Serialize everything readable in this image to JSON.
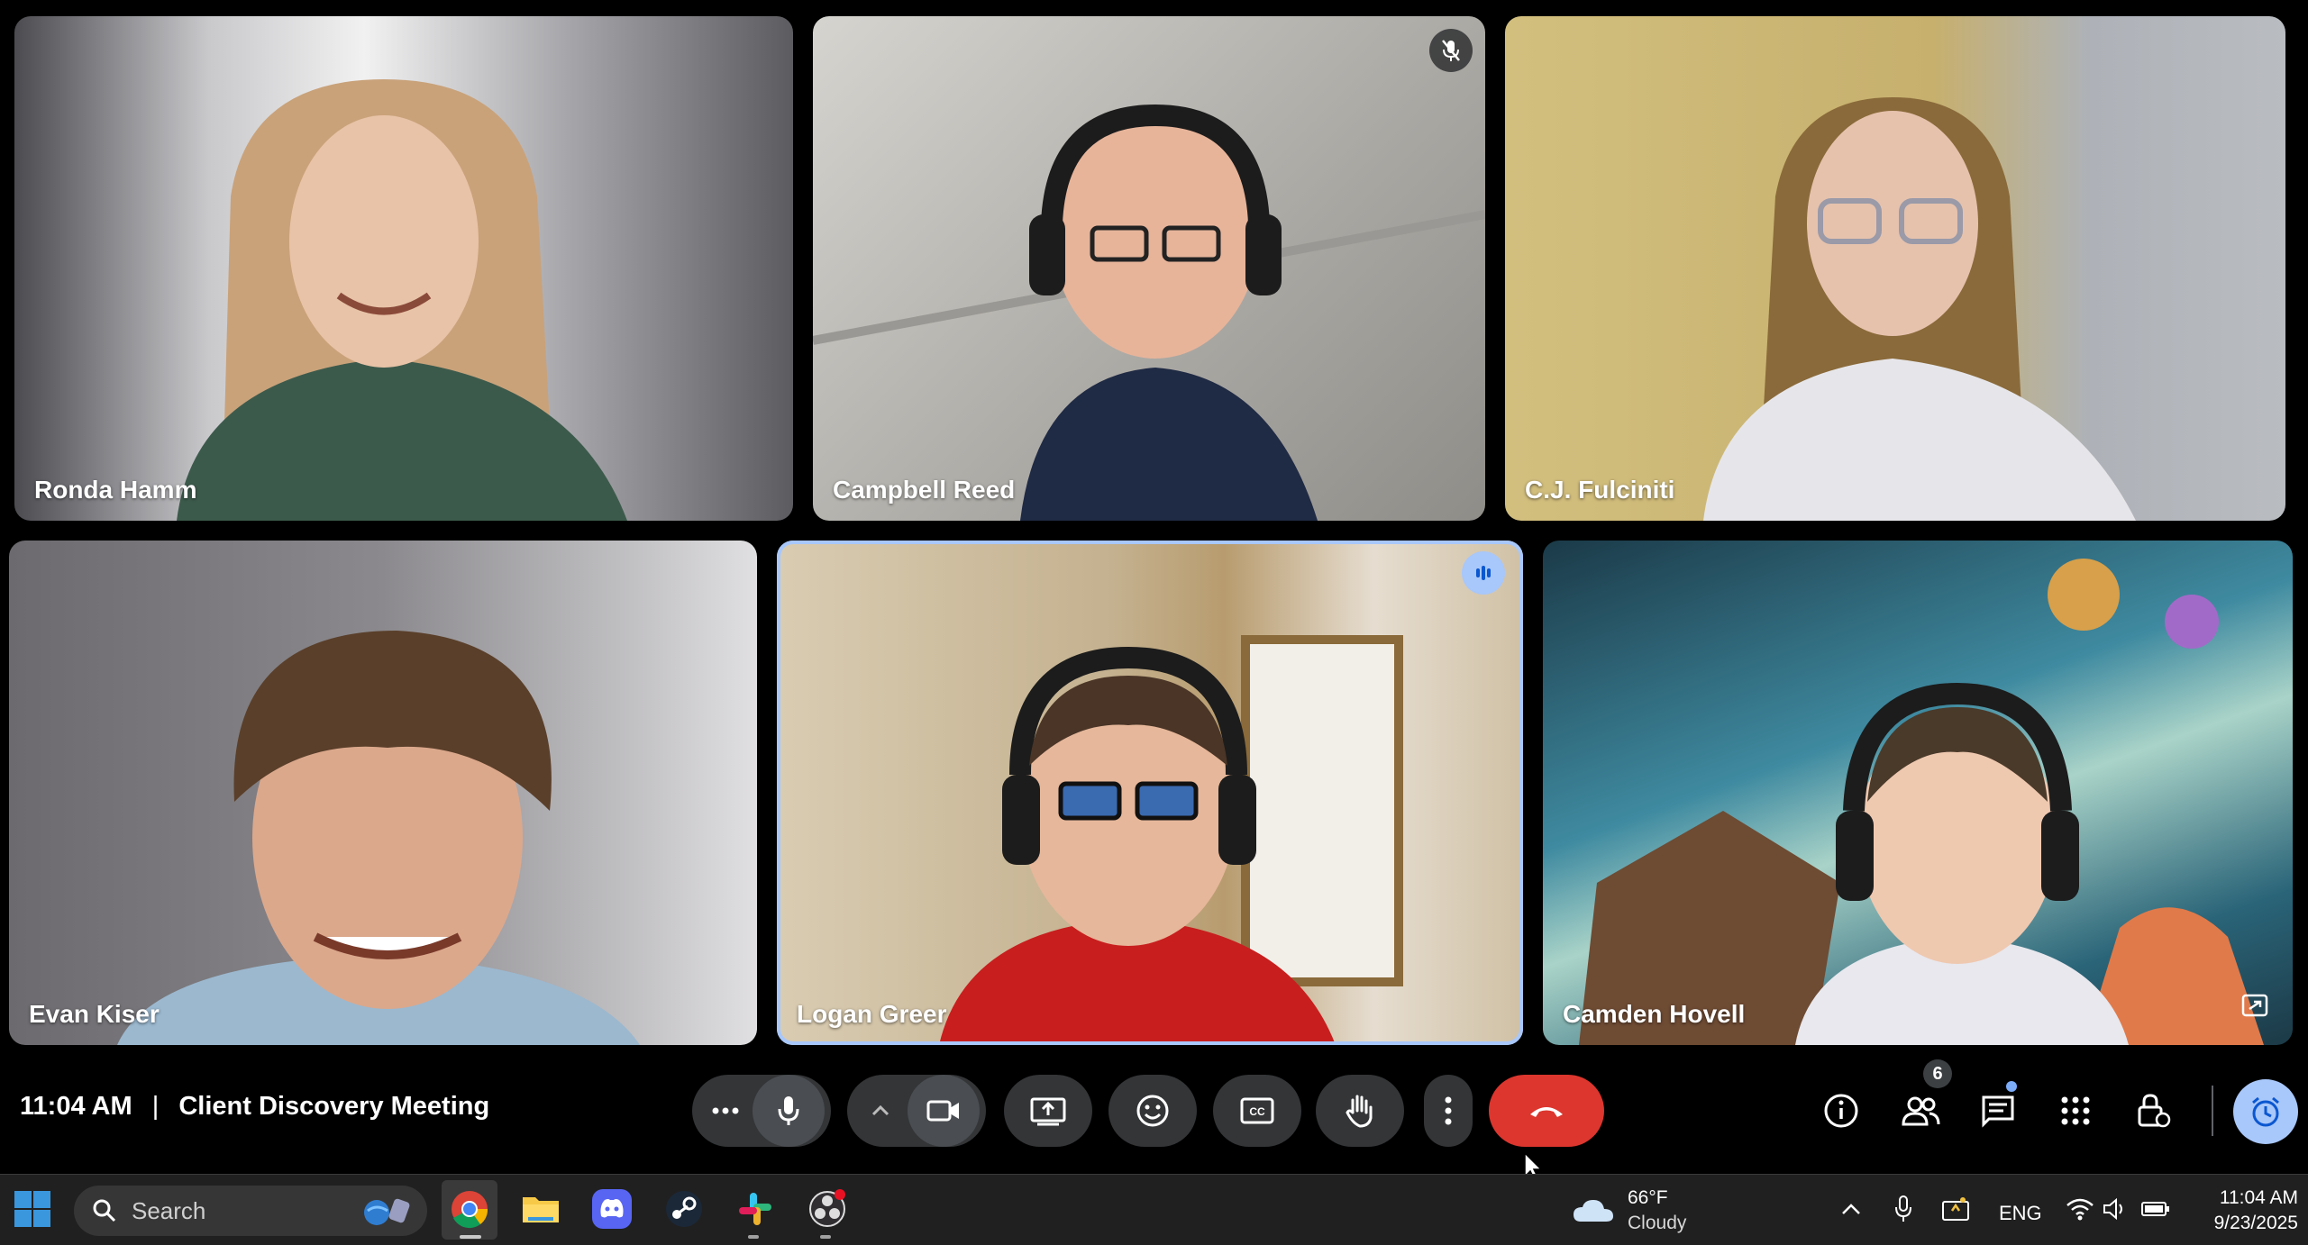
{
  "participants": [
    {
      "name": "Ronda Hamm",
      "bg": "#9a9aa0",
      "skin": "#e8c3a7",
      "hair": "#c9a27a",
      "shirt": "#4a6a5a"
    },
    {
      "name": "Campbell Reed",
      "bg": "#b8b6b0",
      "skin": "#e7b49a",
      "hair": "#c79a68",
      "shirt": "#1f2a44"
    },
    {
      "name": "C.J. Fulciniti",
      "bg": "#c9b67a",
      "skin": "#e6c2ad",
      "hair": "#8a6a3a",
      "shirt": "#e6e6ea"
    },
    {
      "name": "Evan Kiser",
      "bg": "#87858a",
      "skin": "#dba88c",
      "hair": "#5a3f2a",
      "shirt": "#9bb8cf"
    },
    {
      "name": "Logan Greer",
      "bg": "#b7a07a",
      "skin": "#e6b79a",
      "hair": "#4a3527",
      "shirt": "#c81e1e"
    },
    {
      "name": "Camden Hovell",
      "bg": "#2f6e8a",
      "skin": "#efc8b0",
      "hair": "#4a3a2a",
      "shirt": "#e8e8ee"
    }
  ],
  "meeting": {
    "time": "11:04 AM",
    "separator": "|",
    "title": "Client Discovery Meeting",
    "participant_count": "6"
  },
  "toolbar": {
    "icons": [
      "more-options-icon",
      "microphone-icon",
      "chevron-up-icon",
      "camera-icon",
      "present-screen-icon",
      "emoji-icon",
      "captions-icon",
      "raise-hand-icon",
      "more-vert-icon",
      "hang-up-icon"
    ],
    "right_icons": [
      "info-icon",
      "people-icon",
      "chat-icon",
      "activities-icon",
      "host-controls-icon",
      "timer-icon"
    ],
    "colors": {
      "hangup": "#dc362e",
      "pill": "#333537",
      "accent": "#a8c7fa"
    }
  },
  "taskbar": {
    "search_placeholder": "Search",
    "weather_temp": "66°F",
    "weather_desc": "Cloudy",
    "language": "ENG",
    "clock_time": "11:04 AM",
    "clock_date": "9/23/2025",
    "apps": [
      "start-icon",
      "chrome-icon",
      "file-explorer-icon",
      "discord-icon",
      "steam-icon",
      "slack-icon",
      "obs-icon"
    ]
  }
}
